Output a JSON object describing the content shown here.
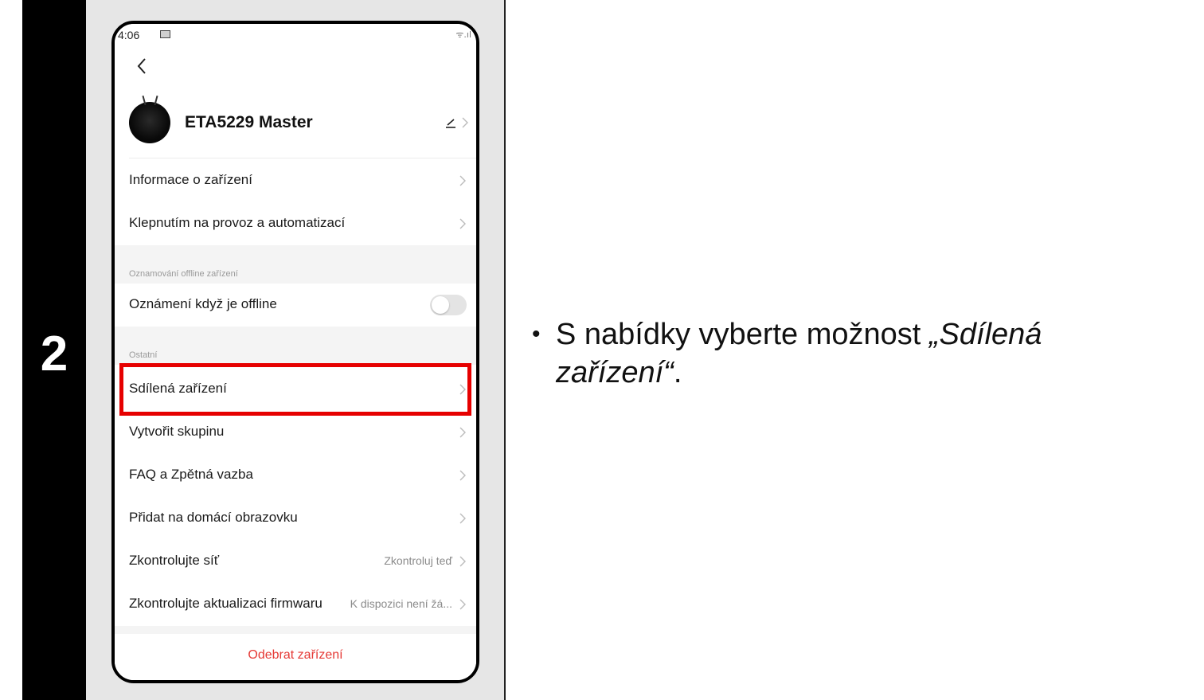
{
  "step": {
    "number": "2"
  },
  "phone": {
    "status_bar": {
      "time": "4:06",
      "signal_text": "ᯤ.ıl"
    },
    "device": {
      "name": "ETA5229 Master"
    },
    "rows": {
      "device_info": "Informace o zařízení",
      "automation": "Klepnutím na provoz a automatizací",
      "offline_section_title": "Oznamování offline zařízení",
      "offline_notify": "Oznámení když je offline",
      "other_section_title": "Ostatní",
      "shared_devices": "Sdílená zařízení",
      "create_group": "Vytvořit skupinu",
      "faq": "FAQ a Zpětná vazba",
      "add_home_screen": "Přidat na domácí obrazovku",
      "check_network": "Zkontrolujte síť",
      "check_network_value": "Zkontroluj teď",
      "check_firmware": "Zkontrolujte aktualizaci firmwaru",
      "check_firmware_value": "K dispozici není žá..."
    },
    "offline_toggle_on": false,
    "remove_button": "Odebrat zařízení"
  },
  "instruction": {
    "bullet": "•",
    "prefix": "S nabídky vyberte možnost ",
    "emphasis": "„Sdílená zařízení“",
    "suffix": "."
  },
  "colors": {
    "highlight": "#e60000",
    "remove_text": "#e53935",
    "left_bar": "#000000",
    "panel": "#e6e6e6"
  }
}
